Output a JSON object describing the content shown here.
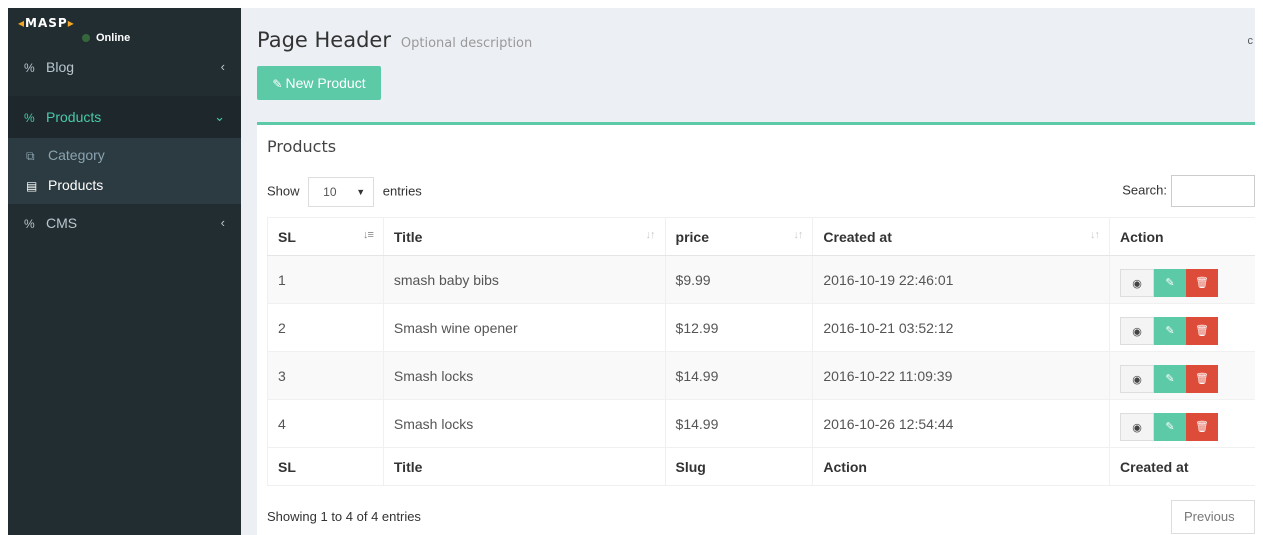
{
  "brand": {
    "logo": "MASP",
    "status": "Online"
  },
  "sidebar": {
    "items": [
      {
        "label": "Blog",
        "chevron": "‹"
      },
      {
        "label": "Products",
        "chevron": "⌄"
      },
      {
        "label": "CMS",
        "chevron": "‹"
      }
    ],
    "subitems": [
      {
        "label": "Category"
      },
      {
        "label": "Products"
      }
    ]
  },
  "header": {
    "title": "Page Header",
    "description": "Optional description",
    "crumb": "c"
  },
  "toolbar": {
    "new_label": "New Product"
  },
  "box": {
    "title": "Products",
    "show_label": "Show",
    "entries_value": "10",
    "entries_label": "entries",
    "search_label": "Search:"
  },
  "table": {
    "headers": [
      "SL",
      "Title",
      "price",
      "Created at",
      "Action"
    ],
    "rows": [
      {
        "sl": "1",
        "title": "smash baby bibs",
        "price": "$9.99",
        "created": "2016-10-19 22:46:01"
      },
      {
        "sl": "2",
        "title": "Smash wine opener",
        "price": "$12.99",
        "created": "2016-10-21 03:52:12"
      },
      {
        "sl": "3",
        "title": "Smash locks",
        "price": "$14.99",
        "created": "2016-10-22 11:09:39"
      },
      {
        "sl": "4",
        "title": "Smash locks",
        "price": "$14.99",
        "created": "2016-10-26 12:54:44"
      }
    ],
    "footers": [
      "SL",
      "Title",
      "Slug",
      "Action",
      "Created at"
    ]
  },
  "footer": {
    "info": "Showing 1 to 4 of 4 entries",
    "previous": "Previous"
  },
  "colors": {
    "accent": "#5cc9a7",
    "danger": "#dd4b39",
    "sidebar": "#222d32"
  }
}
